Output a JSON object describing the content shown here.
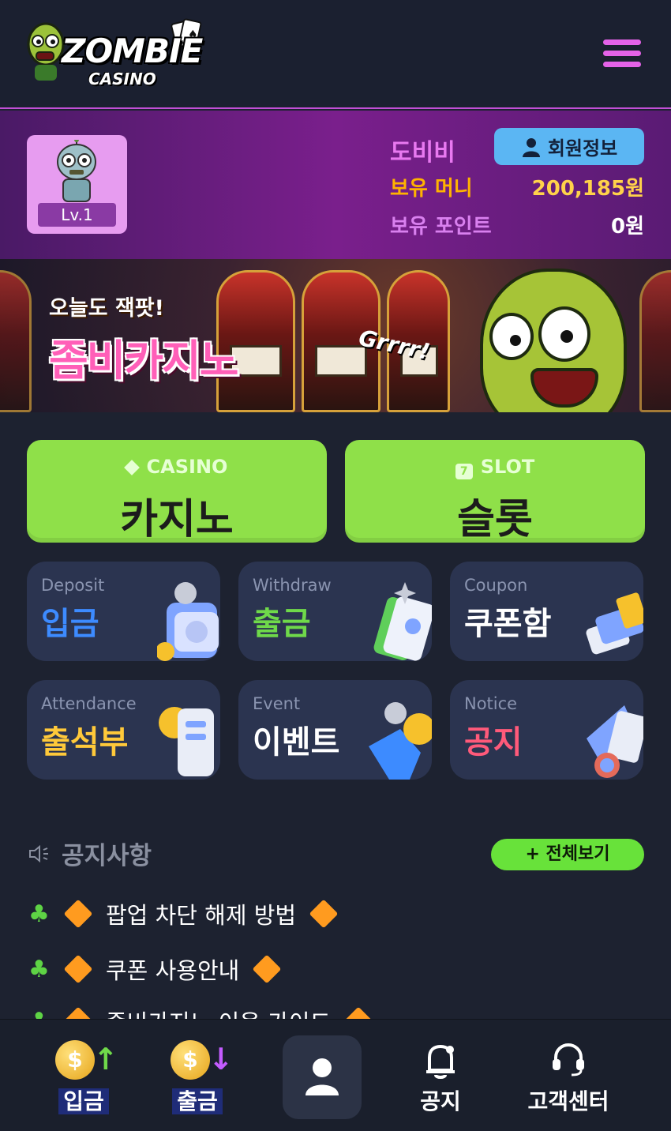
{
  "header": {
    "logo_text": "ZOMBIE",
    "logo_subtext": "CASINO",
    "menu_icon": "hamburger-menu-icon"
  },
  "user": {
    "level": "Lv.1",
    "username": "도비비",
    "member_info_label": "회원정보",
    "money_label": "보유 머니",
    "money_value": "200,185원",
    "point_label": "보유 포인트",
    "point_value": "0원"
  },
  "banner": {
    "line1": "오늘도 잭팟!",
    "line2": "좀비카지노",
    "grr": "Grrrr!"
  },
  "main_buttons": [
    {
      "en": "CASINO",
      "ko": "카지노",
      "icon": "diamond-icon"
    },
    {
      "en": "SLOT",
      "ko": "슬롯",
      "icon": "slot-seven-icon"
    }
  ],
  "tiles": [
    {
      "en": "Deposit",
      "ko": "입금",
      "color": "#3d8bff",
      "icon": "wallet-coin-icon"
    },
    {
      "en": "Withdraw",
      "ko": "출금",
      "color": "#6fd94a",
      "icon": "cash-stack-icon"
    },
    {
      "en": "Coupon",
      "ko": "쿠폰함",
      "color": "#ffffff",
      "icon": "coupon-icon"
    },
    {
      "en": "Attendance",
      "ko": "출석부",
      "color": "#ffc93a",
      "icon": "receipt-coin-icon"
    },
    {
      "en": "Event",
      "ko": "이벤트",
      "color": "#ffffff",
      "icon": "gift-coin-icon"
    },
    {
      "en": "Notice",
      "ko": "공지",
      "color": "#ff5a7a",
      "icon": "megaphone-icon"
    }
  ],
  "notices": {
    "title": "공지사항",
    "view_all": "+ 전체보기",
    "items": [
      "팝업 차단 해제 방법",
      "쿠폰 사용안내",
      "좀비카지노 이용 가이드"
    ]
  },
  "bottom_nav": [
    {
      "label": "입금",
      "icon": "deposit-coin-icon"
    },
    {
      "label": "출금",
      "icon": "withdraw-coin-icon"
    },
    {
      "label": "",
      "icon": "user-profile-icon"
    },
    {
      "label": "공지",
      "icon": "bell-notice-icon"
    },
    {
      "label": "고객센터",
      "icon": "headset-icon"
    }
  ]
}
